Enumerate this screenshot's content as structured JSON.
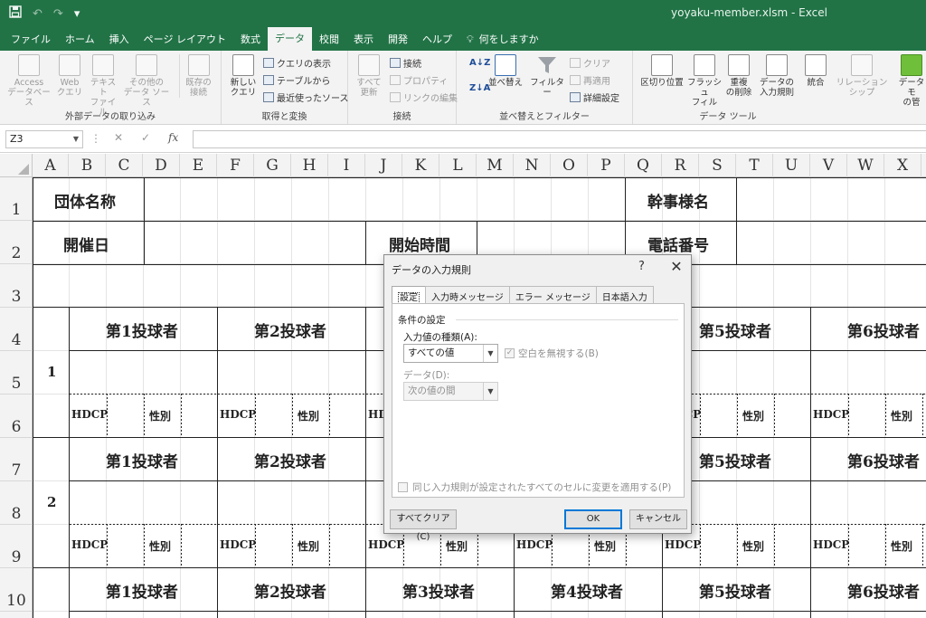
{
  "window": {
    "title": "yoyaku-member.xlsm  -  Excel",
    "qat": {
      "save_icon": "save-icon",
      "undo_icon": "undo-icon",
      "redo_icon": "redo-icon",
      "customize": "▾"
    }
  },
  "tabs": [
    "ファイル",
    "ホーム",
    "挿入",
    "ページ レイアウト",
    "数式",
    "データ",
    "校閲",
    "表示",
    "開発",
    "ヘルプ",
    "何をしますか"
  ],
  "active_tab": "データ",
  "ribbon": {
    "external": {
      "label": "外部データの取り込み",
      "access": [
        "Access",
        "データベース"
      ],
      "web": [
        "Web",
        "クエリ"
      ],
      "text": [
        "テキスト",
        "ファイル"
      ],
      "other": [
        "その他の",
        "データ ソース"
      ],
      "existing": [
        "既存の",
        "接続"
      ]
    },
    "transform": {
      "label": "取得と変換",
      "new_query": [
        "新しい",
        "クエリ"
      ],
      "show_query": "クエリの表示",
      "from_table": "テーブルから",
      "recent": "最近使ったソース"
    },
    "connections": {
      "label": "接続",
      "refresh": [
        "すべて",
        "更新"
      ],
      "connections": "接続",
      "properties": "プロパティ",
      "edit_links": "リンクの編集"
    },
    "sort_filter": {
      "label": "並べ替えとフィルター",
      "sort": "並べ替え",
      "filter": "フィルター",
      "clear": "クリア",
      "reapply": "再適用",
      "advanced": "詳細設定"
    },
    "tools": {
      "label": "データ ツール",
      "text_to_columns": "区切り位置",
      "flash_fill": [
        "フラッシュ",
        "フィル"
      ],
      "remove_dup": [
        "重複",
        "の削除"
      ],
      "validation": [
        "データの",
        "入力規則"
      ],
      "consolidate": "統合",
      "relationships": "リレーションシップ",
      "data_model": [
        "データ モ",
        "の管"
      ]
    }
  },
  "formula_bar": {
    "name_box": "Z3",
    "fx": "fx",
    "formula": ""
  },
  "columns": [
    "A",
    "B",
    "C",
    "D",
    "E",
    "F",
    "G",
    "H",
    "I",
    "J",
    "K",
    "L",
    "M",
    "N",
    "O",
    "P",
    "Q",
    "R",
    "S",
    "T",
    "U",
    "V",
    "W",
    "X"
  ],
  "rows": [
    "1",
    "2",
    "3",
    "4",
    "5",
    "6",
    "7",
    "8",
    "9",
    "10"
  ],
  "sheet": {
    "group_name_label": "団体名称",
    "event_date_label": "開催日",
    "start_time_label": "開始時間",
    "organizer_label": "幹事様名",
    "phone_label": "電話番号",
    "lane_numbers": [
      "1",
      "2"
    ],
    "bowler_labels": [
      "第1投球者",
      "第2投球者",
      "第3投球者",
      "第4投球者",
      "第5投球者",
      "第6投球者"
    ],
    "hdcp_label": "HDCP",
    "gender_label": "性別"
  },
  "dialog": {
    "title": "データの入力規則",
    "help": "?",
    "close": "✕",
    "tabs": [
      "設定",
      "入力時メッセージ",
      "エラー メッセージ",
      "日本語入力"
    ],
    "section_title": "条件の設定",
    "allow_label": "入力値の種類(A):",
    "allow_value": "すべての値",
    "ignore_blank_label": "空白を無視する(B)",
    "ignore_blank_checked": true,
    "data_label": "データ(D):",
    "data_value": "次の値の間",
    "apply_all_label": "同じ入力規則が設定されたすべてのセルに変更を適用する(P)",
    "apply_all_checked": false,
    "clear_all_button": "すべてクリア(C)",
    "ok_button": "OK",
    "cancel_button": "キャンセル"
  }
}
